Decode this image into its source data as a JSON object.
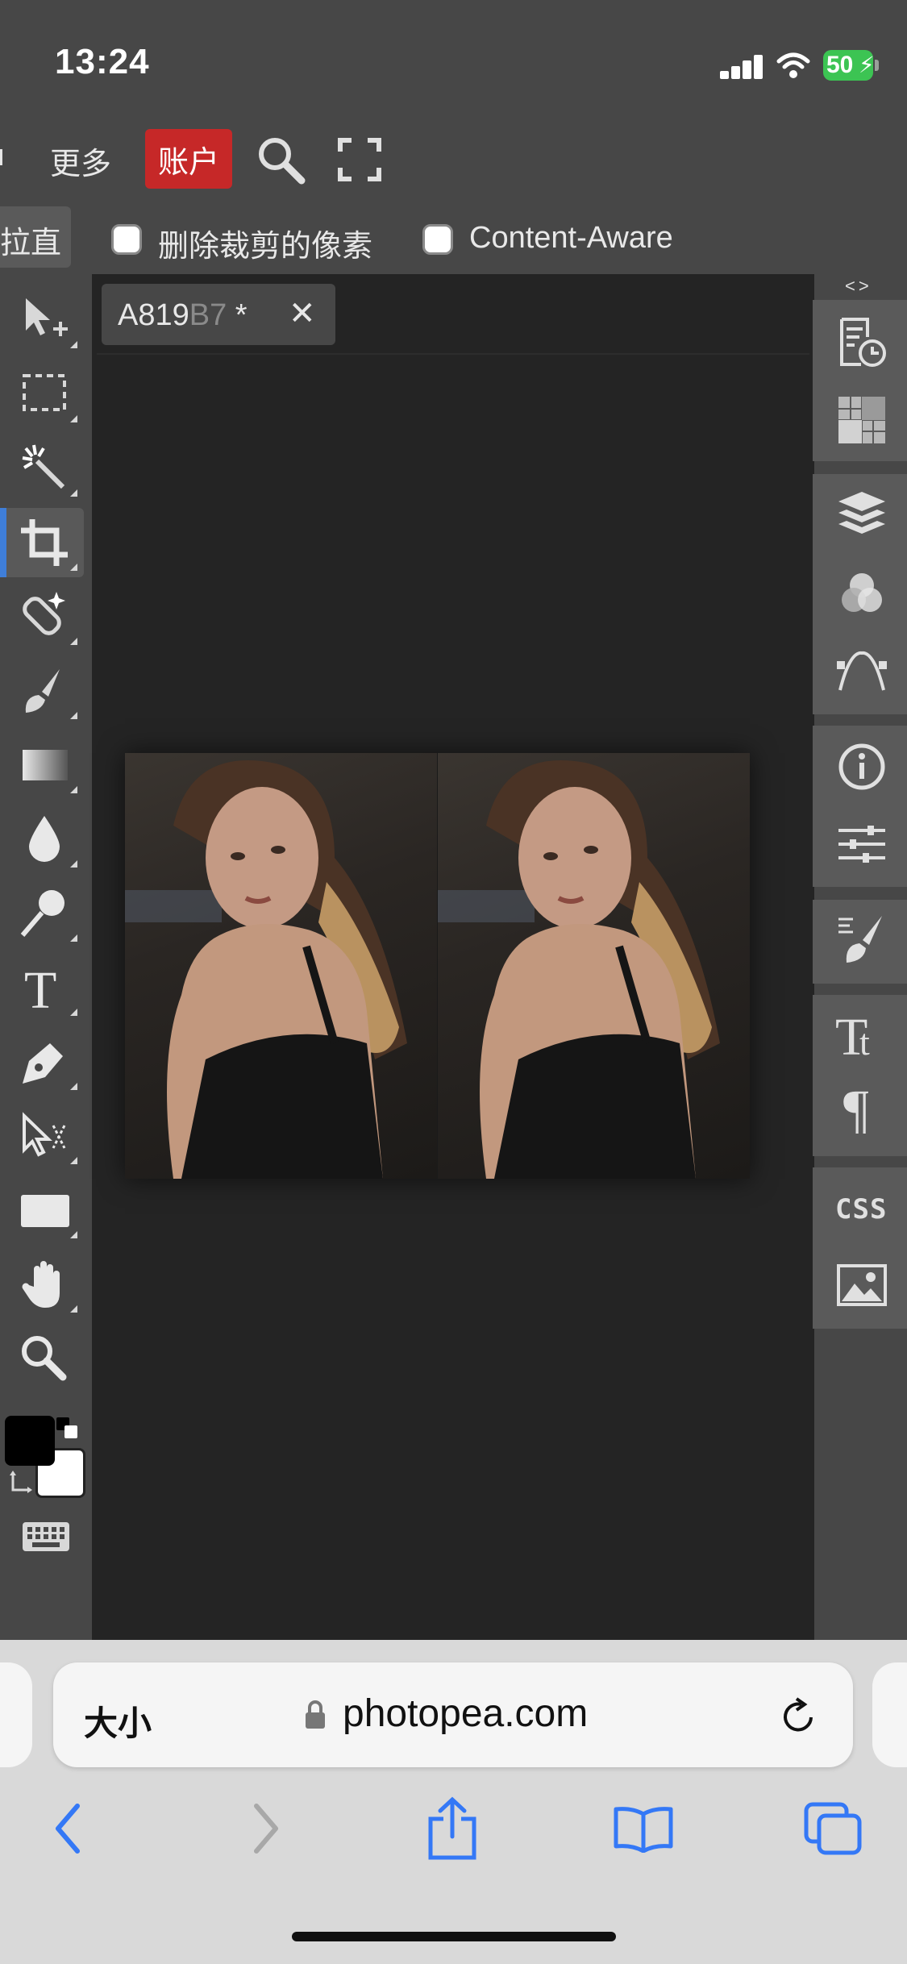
{
  "status_bar": {
    "time": "13:24",
    "battery_percent": "50"
  },
  "menu": {
    "partial_item": "ı",
    "more": "更多",
    "account": "账户"
  },
  "options": {
    "straighten": "拉直",
    "delete_cropped_pixels": "删除裁剪的像素",
    "delete_cropped_checked": false,
    "content_aware": "Content-Aware",
    "content_aware_checked": false
  },
  "document": {
    "tab_title": "A819",
    "tab_title_faded": "B7",
    "modified_marker": "*",
    "close": "✕"
  },
  "left_tools": [
    "move-tool-icon",
    "marquee-tool-icon",
    "magic-wand-icon",
    "crop-tool-icon",
    "healing-brush-icon",
    "brush-tool-icon",
    "gradient-tool-icon",
    "blur-tool-icon",
    "dodge-tool-icon",
    "type-tool-icon",
    "pen-tool-icon",
    "path-select-icon",
    "rectangle-tool-icon",
    "hand-tool-icon",
    "zoom-tool-icon",
    "keyboard-icon"
  ],
  "active_tool": "crop-tool-icon",
  "colors": {
    "foreground": "#000000",
    "background": "#ffffff",
    "accent": "#3f7ed8",
    "account_red": "#c62828"
  },
  "right_panel": {
    "collapse_toggle": "<>",
    "icons": [
      "history-icon",
      "swatches-icon",
      "layers-icon",
      "channels-icon",
      "paths-icon",
      "info-icon",
      "adjustments-icon",
      "brush-settings-icon",
      "character-icon",
      "paragraph-icon",
      "css-icon",
      "image-icon"
    ],
    "css_label": "CSS"
  },
  "browser": {
    "text_size": "大小",
    "url": "photopea.com"
  }
}
